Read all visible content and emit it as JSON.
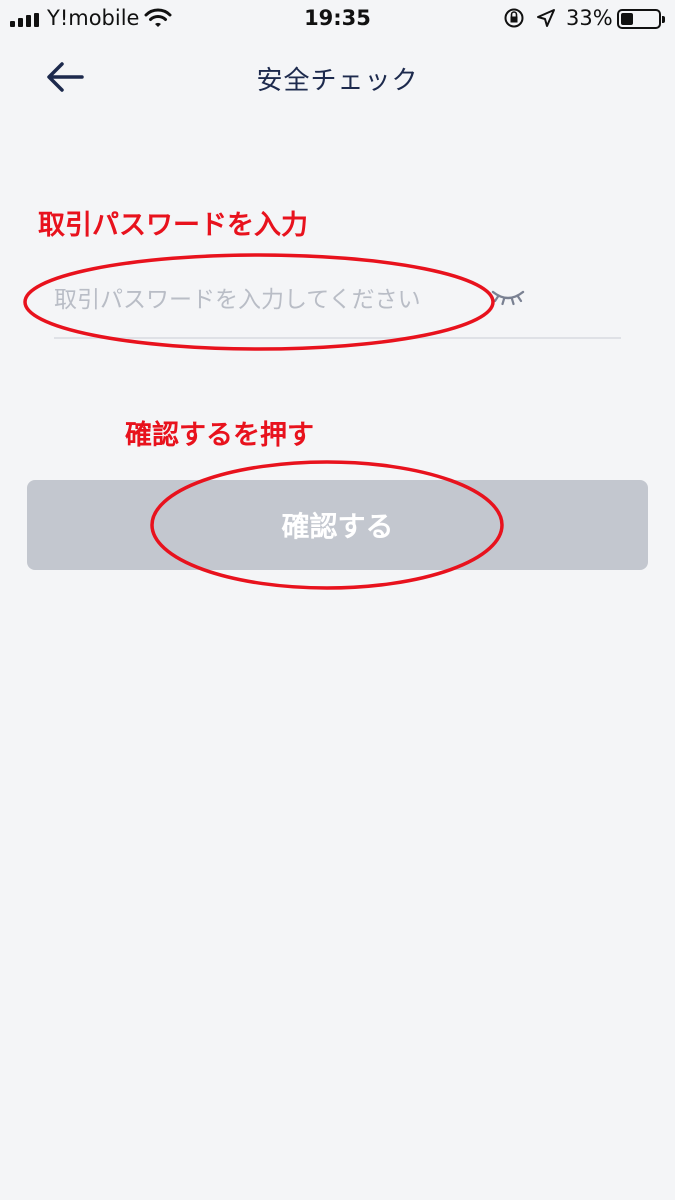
{
  "status_bar": {
    "carrier": "Y!mobile",
    "time": "19:35",
    "battery_percent": "33%",
    "battery_level": 0.33
  },
  "nav": {
    "title": "安全チェック",
    "back_icon": "arrow-left-icon"
  },
  "annotations": {
    "input_note": "取引パスワードを入力",
    "button_note": "確認するを押す",
    "highlight_color": "#e8121d"
  },
  "form": {
    "password_placeholder": "取引パスワードを入力してください",
    "password_value": "",
    "visibility_icon": "eye-closed-icon",
    "confirm_label": "確認する"
  },
  "colors": {
    "background": "#f4f5f7",
    "title_text": "#1d2a4d",
    "button_disabled": "#c3c7cf"
  }
}
